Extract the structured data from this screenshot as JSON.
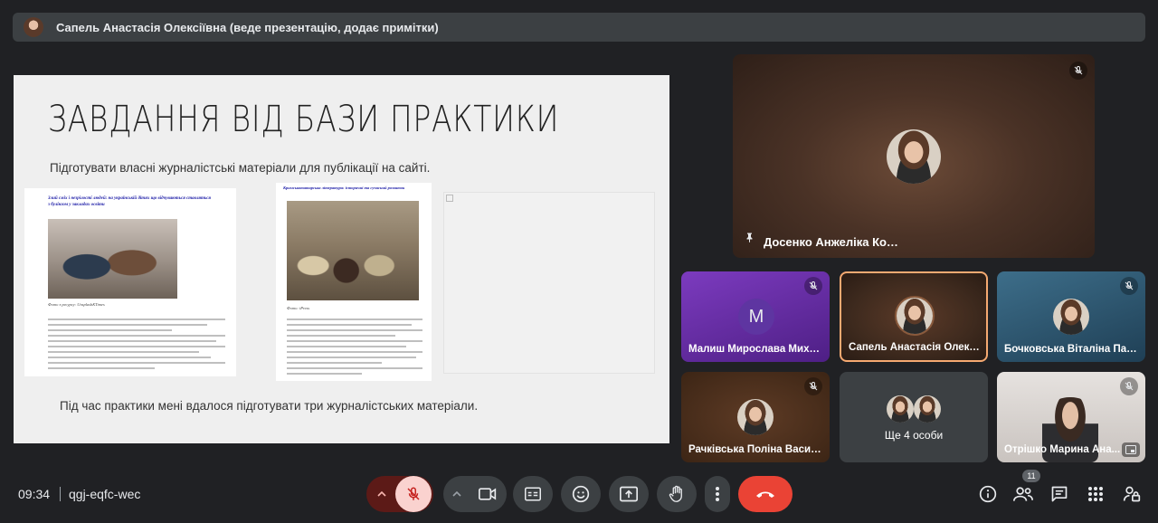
{
  "presenter_bar": {
    "text": "Сапель Анастасія Олексіївна (веде презентацію, додає примітки)"
  },
  "slide": {
    "title": "ЗАВДАННЯ ВІД БАЗИ ПРАКТИКИ",
    "subtitle": "Підготувати власні журналістські матеріали для публікації на сайті.",
    "footer": "Під час практики мені вдалося підготувати три журналістських матеріали.",
    "article1": {
      "headline": "Злий сміх і незрілості людей: на українській дітях що відчуваються ставляться з булінгом у закладах освіти",
      "caption": "Фото з ресурсу: UnsplashKTimes"
    },
    "article2": {
      "headline": "Кримськотатарська література: історичні та сучасний розвиток",
      "caption": "Фото: iPress"
    }
  },
  "participants": {
    "pinned": {
      "name": "Досенко Анжеліка Костянтинівна"
    },
    "tiles": [
      {
        "name": "Малиш Мирослава Михай...",
        "initial": "M",
        "muted": true
      },
      {
        "name": "Сапель Анастасія Олексіїв...",
        "muted": false
      },
      {
        "name": "Бочковська Віталіна Павлі...",
        "muted": true
      },
      {
        "name": "Рачківська Поліна Василів...",
        "muted": true
      },
      {
        "name": "Ще 4 особи"
      },
      {
        "name": "Отрішко Марина Ана...",
        "muted": true
      }
    ]
  },
  "meeting": {
    "time": "09:34",
    "code": "qgj-eqfc-wec",
    "participants_count": "11"
  },
  "icons": {
    "mic": "mic-off-icon",
    "camera": "camera-icon",
    "captions": "captions-icon",
    "emoji": "emoji-icon",
    "present": "present-screen-icon",
    "hand": "raise-hand-icon",
    "more": "more-vert-icon",
    "end": "end-call-icon",
    "info": "info-icon",
    "people": "people-icon",
    "chat": "chat-icon",
    "activities": "apps-grid-icon",
    "host": "host-controls-icon"
  },
  "colors": {
    "mic_off_bg": "#fad2cf",
    "mic_off_fg": "#c5221f",
    "end_call": "#ea4335",
    "speaking_border": "#f5a971"
  }
}
